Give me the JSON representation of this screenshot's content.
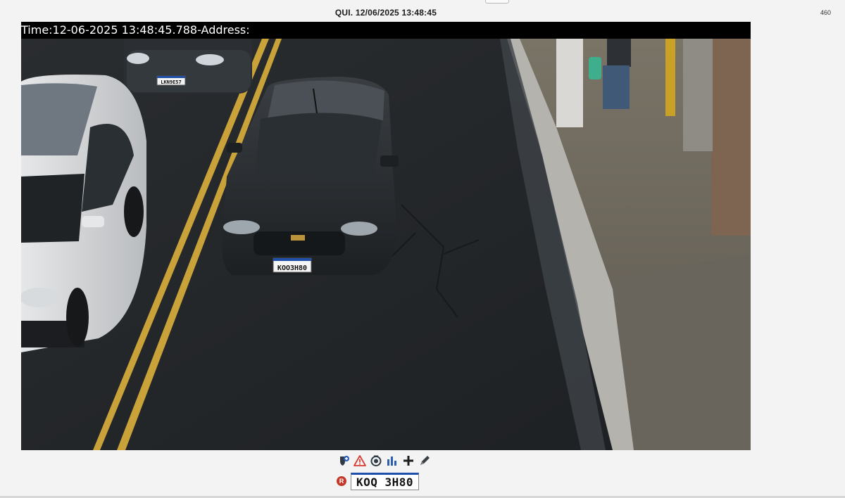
{
  "header": {
    "datetime": "QUI. 12/06/2025 13:48:45",
    "counter": "460"
  },
  "camera": {
    "overlay_text": "Time:12-06-2025 13:48:45.788-Address:",
    "plates": {
      "parked_car": "LKN9E57",
      "main_car": "KOO3H80"
    }
  },
  "toolbar": {
    "icons": [
      "shield-plus-icon",
      "warning-icon",
      "camera-icon",
      "bar-chart-icon",
      "plus-icon",
      "edit-pen-icon"
    ]
  },
  "recognition": {
    "badge": "R",
    "plate": "KOQ 3H80"
  },
  "colors": {
    "overlay_bg": "#000000",
    "badge": "#c0392b",
    "plate_border_top": "#1f4fa8",
    "warning": "#d63b2f",
    "accent_blue": "#2c5fb3"
  }
}
